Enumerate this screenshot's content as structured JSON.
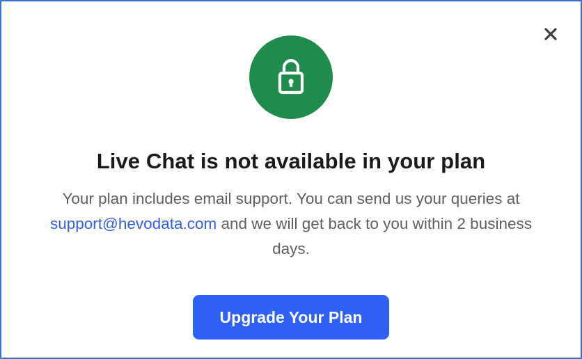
{
  "dialog": {
    "close_icon": "close-icon",
    "lock_icon": "lock-icon",
    "title": "Live Chat is not available in your plan",
    "body_prefix": "Your plan includes email support. You can send us your queries at ",
    "support_email": "support@hevodata.com",
    "body_suffix": " and we will get back to you within 2 business days.",
    "upgrade_label": "Upgrade Your Plan",
    "colors": {
      "accent": "#2e61f5",
      "lock_circle": "#1f8c4d",
      "link": "#2f5fe5"
    }
  }
}
